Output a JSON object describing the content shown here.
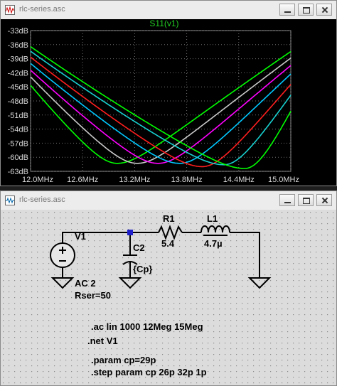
{
  "plot_window": {
    "title": "rlc-series.asc",
    "trace_label": "S11(v1)",
    "trace_label_color": "#22cc22"
  },
  "schematic_window": {
    "title": "rlc-series.asc",
    "components": {
      "source_name": "V1",
      "source_value": "AC 2",
      "source_rser": "Rser=50",
      "capacitor_name": "C2",
      "capacitor_value": "{Cp}",
      "resistor_name": "R1",
      "resistor_value": "5.4",
      "inductor_name": "L1",
      "inductor_value": "4.7µ"
    },
    "directives": {
      "ac": ".ac lin 1000 12Meg 15Meg",
      "net": ".net V1",
      "param": ".param cp=29p",
      "step": ".step param cp 26p 32p 1p"
    }
  },
  "chart_data": {
    "type": "line",
    "title": "S11(v1)",
    "xlabel": "",
    "ylabel": "",
    "x_unit": "MHz",
    "y_unit": "dB",
    "xlim": [
      12.0,
      15.0
    ],
    "ylim": [
      -63,
      -33
    ],
    "x_ticks": [
      "12.0MHz",
      "12.6MHz",
      "13.2MHz",
      "13.8MHz",
      "14.4MHz",
      "15.0MHz"
    ],
    "y_ticks": [
      "-33dB",
      "-36dB",
      "-39dB",
      "-42dB",
      "-45dB",
      "-48dB",
      "-51dB",
      "-54dB",
      "-57dB",
      "-60dB",
      "-63dB"
    ],
    "grid": true,
    "background": "#000000",
    "series": [
      {
        "color": "#00ff00",
        "dip_freq_mhz": 13.0,
        "min_db": -61.3,
        "edge_db_12mhz": -40.0,
        "edge_db_15mhz": -33.9
      },
      {
        "color": "#c8c8c8",
        "dip_freq_mhz": 13.23,
        "min_db": -61.3,
        "edge_db_12mhz": -38.7,
        "edge_db_15mhz": -35.0
      },
      {
        "color": "#ff00ff",
        "dip_freq_mhz": 13.47,
        "min_db": -61.3,
        "edge_db_12mhz": -37.7,
        "edge_db_15mhz": -36.2
      },
      {
        "color": "#00c8ff",
        "dip_freq_mhz": 13.72,
        "min_db": -61.3,
        "edge_db_12mhz": -36.6,
        "edge_db_15mhz": -37.5
      },
      {
        "color": "#ff1e1e",
        "dip_freq_mhz": 13.98,
        "min_db": -62.0,
        "edge_db_12mhz": -35.4,
        "edge_db_15mhz": -38.8
      },
      {
        "color": "#18d0d0",
        "dip_freq_mhz": 14.23,
        "min_db": -61.6,
        "edge_db_12mhz": -34.4,
        "edge_db_15mhz": -40.1
      },
      {
        "color": "#00ff00",
        "dip_freq_mhz": 14.47,
        "min_db": -62.4,
        "edge_db_12mhz": -33.5,
        "edge_db_15mhz": -41.6
      }
    ]
  }
}
